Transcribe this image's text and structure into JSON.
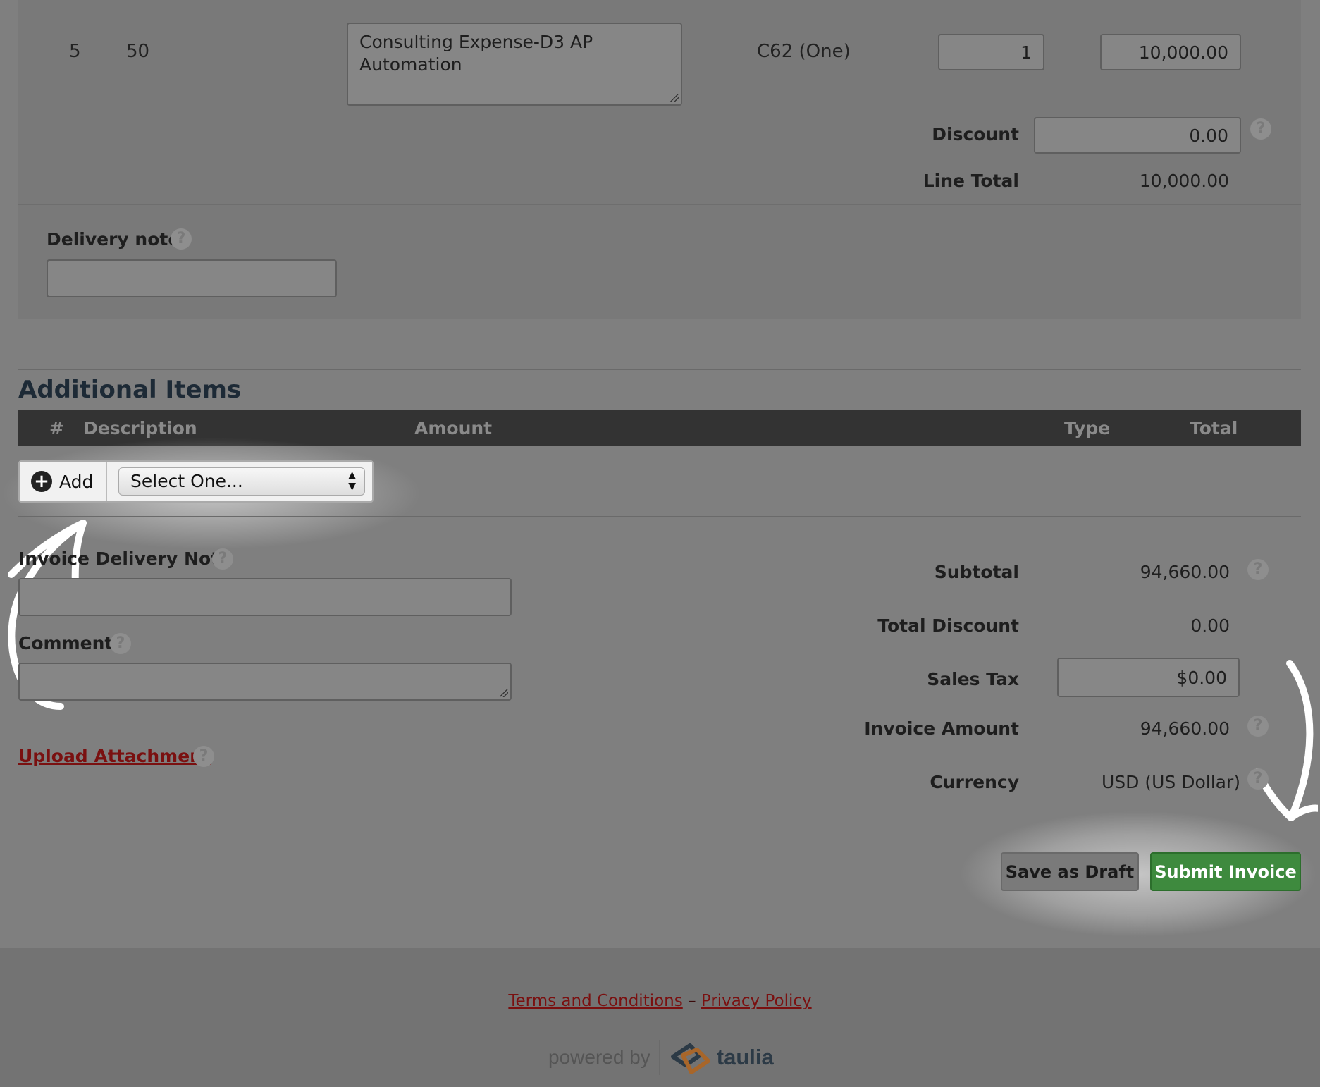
{
  "line_item": {
    "number": "5",
    "code": "50",
    "description": "Consulting Expense-D3 AP Automation",
    "unit": "C62 (One)",
    "quantity": "1",
    "price": "10,000.00",
    "discount_label": "Discount",
    "discount_value": "0.00",
    "line_total_label": "Line Total",
    "line_total_value": "10,000.00",
    "delivery_note_label": "Delivery note",
    "delivery_note_value": ""
  },
  "additional_items": {
    "title": "Additional Items",
    "columns": [
      "#",
      "Description",
      "Amount",
      "Type",
      "Total"
    ],
    "add_label": "Add",
    "select_value": "Select One..."
  },
  "invoice_form": {
    "delivery_note_label": "Invoice Delivery Note",
    "delivery_note_value": "",
    "comment_label": "Comment",
    "comment_value": "",
    "upload_label": "Upload Attachment"
  },
  "totals": {
    "subtotal_label": "Subtotal",
    "subtotal_value": "94,660.00",
    "total_discount_label": "Total Discount",
    "total_discount_value": "0.00",
    "sales_tax_label": "Sales Tax",
    "sales_tax_value": "$0.00",
    "invoice_amount_label": "Invoice Amount",
    "invoice_amount_value": "94,660.00",
    "currency_label": "Currency",
    "currency_value": "USD (US Dollar)"
  },
  "actions": {
    "save_draft": "Save as Draft",
    "submit": "Submit Invoice"
  },
  "footer": {
    "terms": "Terms and Conditions",
    "separator": "–",
    "privacy": "Privacy Policy",
    "powered_by": "powered by",
    "brand": "taulia"
  },
  "help_glyph": "?",
  "colors": {
    "submit_green": "#3e8a3e",
    "link_red": "#7a1010",
    "table_header": "#333333"
  }
}
